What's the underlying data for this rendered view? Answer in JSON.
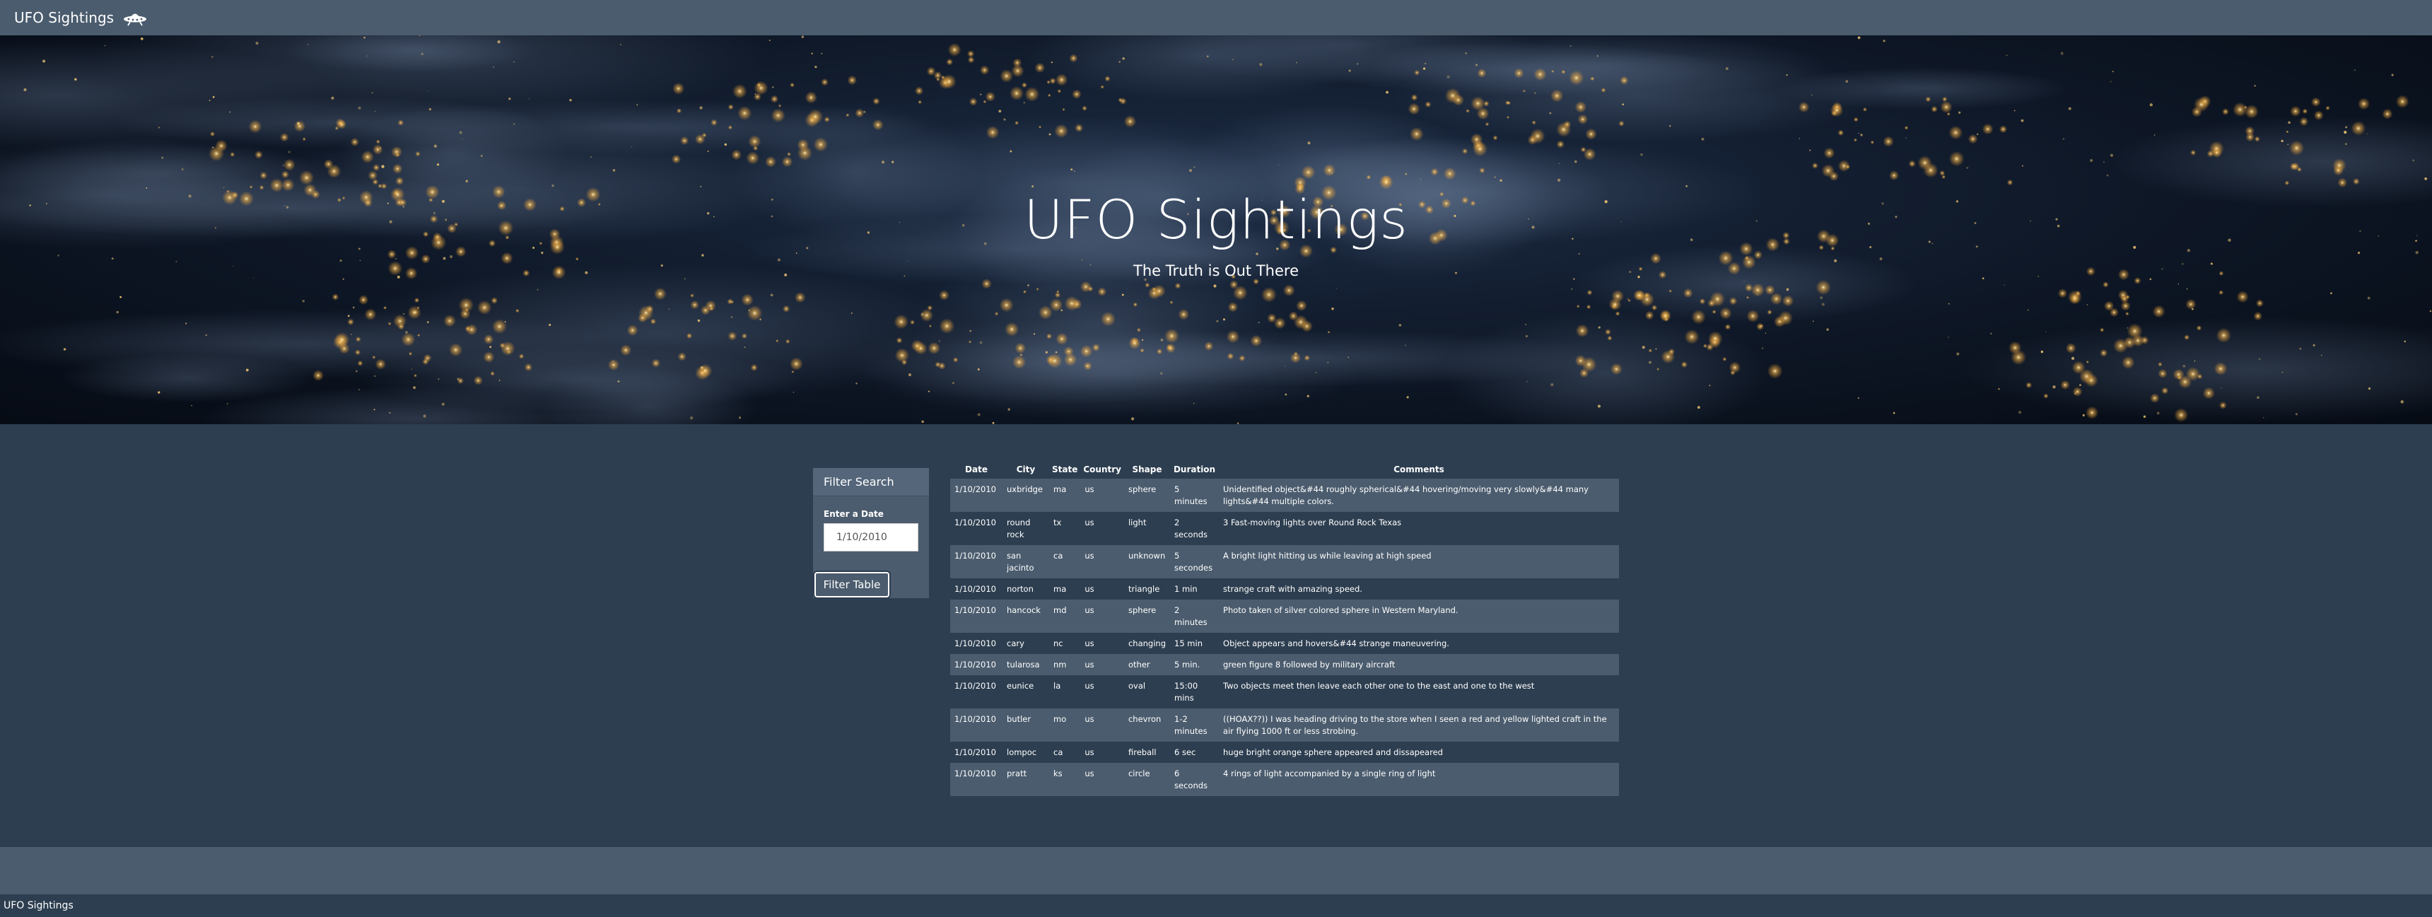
{
  "navbar": {
    "brand": "UFO Sightings",
    "icon": "ufo-icon"
  },
  "hero": {
    "title": "UFO Sightings",
    "subtitle": "The Truth is Out There"
  },
  "filter": {
    "header": "Filter Search",
    "label": "Enter a Date",
    "input_value": "1/10/2010",
    "button_label": "Filter Table"
  },
  "table": {
    "headers": [
      "Date",
      "City",
      "State",
      "Country",
      "Shape",
      "Duration",
      "Comments"
    ],
    "rows": [
      [
        "1/10/2010",
        "uxbridge",
        "ma",
        "us",
        "sphere",
        "5 minutes",
        "Unidentified object&#44 roughly spherical&#44 hovering/moving very slowly&#44 many lights&#44 multiple colors."
      ],
      [
        "1/10/2010",
        "round rock",
        "tx",
        "us",
        "light",
        "2 seconds",
        "3 Fast-moving lights over Round Rock Texas"
      ],
      [
        "1/10/2010",
        "san jacinto",
        "ca",
        "us",
        "unknown",
        "5 secondes",
        "A bright light hitting us while leaving at high speed"
      ],
      [
        "1/10/2010",
        "norton",
        "ma",
        "us",
        "triangle",
        "1 min",
        "strange craft with amazing speed."
      ],
      [
        "1/10/2010",
        "hancock",
        "md",
        "us",
        "sphere",
        "2 minutes",
        "Photo taken of silver colored sphere in Western Maryland."
      ],
      [
        "1/10/2010",
        "cary",
        "nc",
        "us",
        "changing",
        "15 min",
        "Object appears and hovers&#44 strange maneuvering."
      ],
      [
        "1/10/2010",
        "tularosa",
        "nm",
        "us",
        "other",
        "5 min.",
        "green figure 8 followed by military aircraft"
      ],
      [
        "1/10/2010",
        "eunice",
        "la",
        "us",
        "oval",
        "15:00 mins",
        "Two objects meet then leave each other one to the east and one to the west"
      ],
      [
        "1/10/2010",
        "butler",
        "mo",
        "us",
        "chevron",
        "1-2 minutes",
        "((HOAX??)) I was heading driving to the store when I seen a red and yellow lighted craft in the air flying 1000 ft or less strobing."
      ],
      [
        "1/10/2010",
        "lompoc",
        "ca",
        "us",
        "fireball",
        "6 sec",
        "huge bright orange sphere appeared and dissapeared"
      ],
      [
        "1/10/2010",
        "pratt",
        "ks",
        "us",
        "circle",
        "6 seconds",
        "4 rings of light accompanied by a single ring of light"
      ]
    ]
  },
  "footer": {
    "text": "UFO Sightings"
  },
  "colors": {
    "navbar": "#4b5c6e",
    "page_background": "#2d3e50",
    "stripe": "#4b5c6e"
  }
}
